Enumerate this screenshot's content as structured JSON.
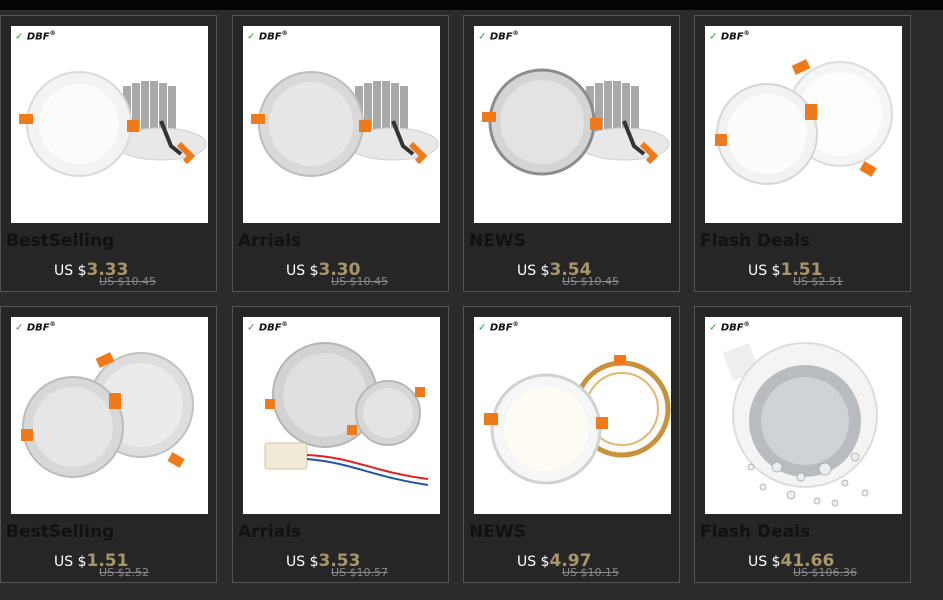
{
  "brand": {
    "mark": "✓",
    "text": "DBF",
    "reg": "®"
  },
  "currency_label": "US $",
  "colors": {
    "background": "#2b2b2b",
    "price": "#a8966a",
    "title": "#111111",
    "old_price": "#8a8a8a"
  },
  "products": [
    {
      "title": "BestSelling",
      "price": "3.33",
      "old_price": "US $10.45",
      "image": "downlight-with-heatsink"
    },
    {
      "title": "Arrials",
      "price": "3.30",
      "old_price": "US $10.45",
      "image": "silver-downlight-with-heatsink"
    },
    {
      "title": "NEWS",
      "price": "3.54",
      "old_price": "US $10.45",
      "image": "silver-downlight-with-heatsink"
    },
    {
      "title": "Flash Deals",
      "price": "1.51",
      "old_price": "US $2.51",
      "image": "two-white-downlights"
    },
    {
      "title": "BestSelling",
      "price": "1.51",
      "old_price": "US $2.52",
      "image": "two-silver-downlights"
    },
    {
      "title": "Arrials",
      "price": "3.53",
      "old_price": "US $10.57",
      "image": "silver-downlights-with-driver"
    },
    {
      "title": "NEWS",
      "price": "4.97",
      "old_price": "US $10.15",
      "image": "white-and-gold-downlights"
    },
    {
      "title": "Flash Deals",
      "price": "41.66",
      "old_price": "US $106.36",
      "image": "waterproof-downlight"
    }
  ]
}
